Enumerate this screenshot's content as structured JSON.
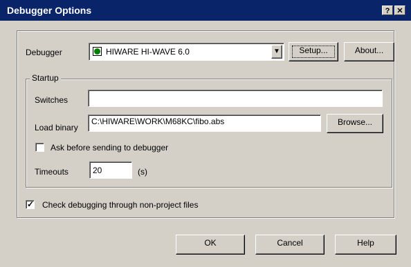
{
  "window": {
    "title": "Debugger Options",
    "help_glyph": "?",
    "close_glyph": "✕"
  },
  "debugger": {
    "label": "Debugger",
    "selected": "HIWARE HI-WAVE 6.0",
    "icon_color": "#008000",
    "setup_label": "Setup...",
    "about_label": "About..."
  },
  "startup": {
    "legend": "Startup",
    "switches_label": "Switches",
    "switches_value": "",
    "load_binary_label": "Load binary",
    "load_binary_value": "C:\\HIWARE\\WORK\\M68KC\\fibo.abs",
    "browse_label": "Browse...",
    "ask_label": "Ask before sending to debugger",
    "ask_checked": false,
    "timeouts_label": "Timeouts",
    "timeouts_value": "20",
    "timeouts_unit": "(s)"
  },
  "check_nonproject": {
    "label": "Check debugging through non-project files",
    "checked": true
  },
  "footer": {
    "ok_label": "OK",
    "cancel_label": "Cancel",
    "help_label": "Help"
  },
  "colors": {
    "titlebar": "#0a246a",
    "face": "#d4d0c8"
  }
}
